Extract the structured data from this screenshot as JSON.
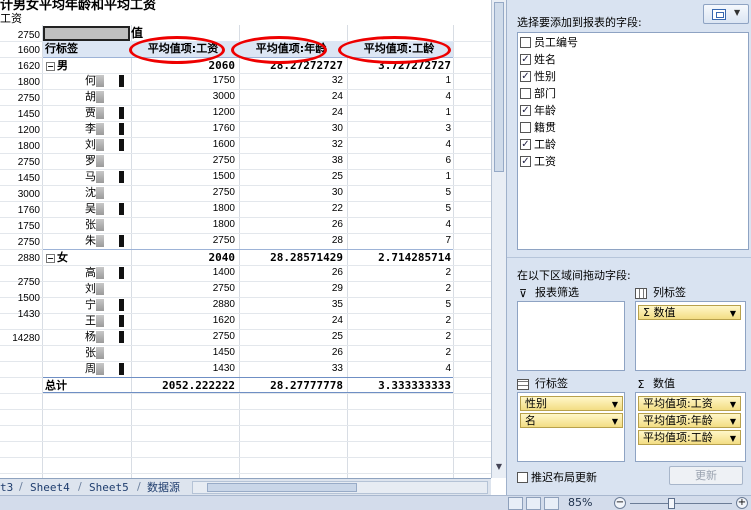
{
  "sheet": {
    "title": "计男女平均年龄和平均工资",
    "gongzi_label": "工资",
    "left_values": [
      "2750",
      "1600",
      "1620",
      "1800",
      "2750",
      "1450",
      "1200",
      "1800",
      "2750",
      "1450",
      "3000",
      "1760",
      "1750",
      "2750",
      "2880",
      "2750",
      "1500",
      "1430",
      "14280"
    ],
    "value_label": "值"
  },
  "pivot": {
    "headers": [
      "行标签",
      "平均值项:工资",
      "平均值项:年龄",
      "平均值项:工龄"
    ],
    "groups": [
      {
        "label": "男",
        "collapse": "−",
        "summary": [
          "2060",
          "28.27272727",
          "3.727272727"
        ],
        "rows": [
          {
            "name": "何",
            "vals": [
              "1750",
              "32",
              "1"
            ]
          },
          {
            "name": "胡",
            "vals": [
              "3000",
              "24",
              "4"
            ]
          },
          {
            "name": "贾",
            "vals": [
              "1200",
              "24",
              "1"
            ]
          },
          {
            "name": "李",
            "vals": [
              "1760",
              "30",
              "3"
            ]
          },
          {
            "name": "刘",
            "vals": [
              "1600",
              "32",
              "4"
            ]
          },
          {
            "name": "罗",
            "vals": [
              "2750",
              "38",
              "6"
            ]
          },
          {
            "name": "马",
            "vals": [
              "1500",
              "25",
              "1"
            ]
          },
          {
            "name": "沈",
            "vals": [
              "2750",
              "30",
              "5"
            ]
          },
          {
            "name": "吴",
            "vals": [
              "1800",
              "22",
              "5"
            ]
          },
          {
            "name": "张",
            "vals": [
              "1800",
              "26",
              "4"
            ]
          },
          {
            "name": "朱",
            "vals": [
              "2750",
              "28",
              "7"
            ]
          }
        ]
      },
      {
        "label": "女",
        "collapse": "−",
        "summary": [
          "2040",
          "28.28571429",
          "2.714285714"
        ],
        "rows": [
          {
            "name": "高",
            "vals": [
              "1400",
              "26",
              "2"
            ]
          },
          {
            "name": "刘",
            "vals": [
              "2750",
              "29",
              "2"
            ]
          },
          {
            "name": "宁",
            "vals": [
              "2880",
              "35",
              "5"
            ]
          },
          {
            "name": "王",
            "vals": [
              "1620",
              "24",
              "2"
            ]
          },
          {
            "name": "杨",
            "vals": [
              "2750",
              "25",
              "2"
            ]
          },
          {
            "name": "张",
            "vals": [
              "1450",
              "26",
              "2"
            ]
          },
          {
            "name": "周",
            "vals": [
              "1430",
              "33",
              "4"
            ]
          }
        ]
      }
    ],
    "total": {
      "label": "总计",
      "vals": [
        "2052.222222",
        "28.27777778",
        "3.333333333"
      ]
    }
  },
  "tabs": {
    "items": [
      "t3",
      "Sheet4",
      "Sheet5",
      "数据源"
    ]
  },
  "status": {
    "zoom": "85%",
    "zoom_out": "−",
    "zoom_in": "+",
    "zoom_level_pct": 85
  },
  "pane": {
    "choose_label": "选择要添加到报表的字段:",
    "fields": [
      {
        "label": "员工编号",
        "checked": false,
        "mark": ""
      },
      {
        "label": "姓名",
        "checked": true,
        "mark": "✓"
      },
      {
        "label": "性别",
        "checked": true,
        "mark": "✓"
      },
      {
        "label": "部门",
        "checked": false,
        "mark": ""
      },
      {
        "label": "年龄",
        "checked": true,
        "mark": "✓"
      },
      {
        "label": "籍贯",
        "checked": false,
        "mark": ""
      },
      {
        "label": "工龄",
        "checked": true,
        "mark": "✓"
      },
      {
        "label": "工资",
        "checked": true,
        "mark": "✓"
      }
    ],
    "drag_label": "在以下区域间拖动字段:",
    "report_filter_label": "报表筛选",
    "column_label": "列标签",
    "row_label": "行标签",
    "values_label": "数值",
    "column_chips": [
      "数值"
    ],
    "row_chips": [
      "性别",
      "名"
    ],
    "value_chips": [
      "平均值项:工资",
      "平均值项:年龄",
      "平均值项:工龄"
    ],
    "defer_label": "推迟布局更新",
    "update_label": "更新",
    "chip_arrow": "▼",
    "sigma": "Σ",
    "filter_icon": "⊽"
  }
}
